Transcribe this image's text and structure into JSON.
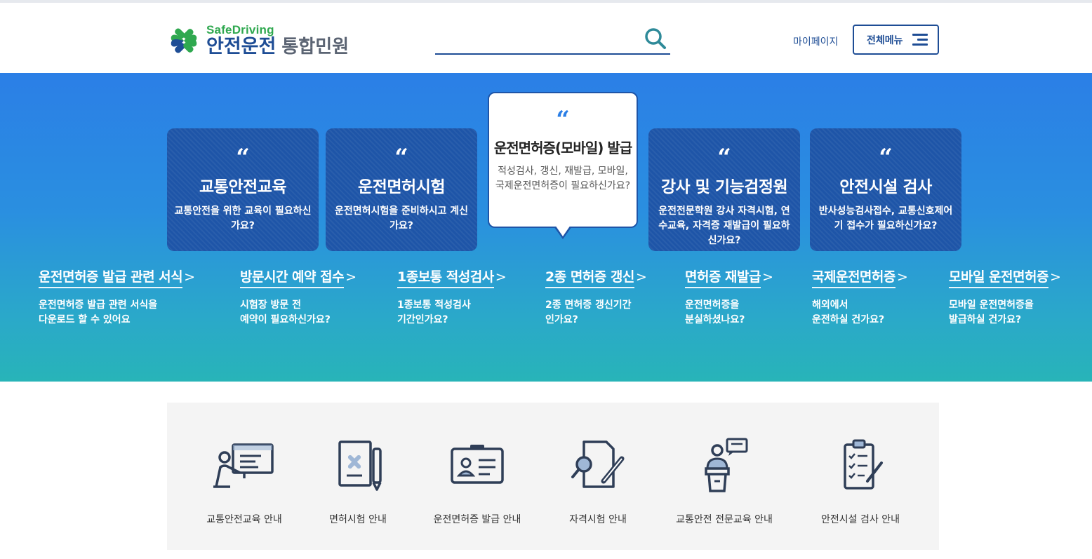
{
  "header": {
    "logo_en": "SafeDriving",
    "logo_ko": "안전운전",
    "logo_sub": "통합민원",
    "search_placeholder": "",
    "mypage": "마이페이지",
    "allmenu": "전체메뉴"
  },
  "colors": {
    "brand_blue": "#1e4d95",
    "brand_green": "#2fa84f",
    "accent_teal": "#2e8a99",
    "hero_top": "#2b7fe6",
    "hero_bottom": "#28b4b8"
  },
  "cards": [
    {
      "title": "교통안전교육",
      "desc": "교통안전을 위한 교육이 필요하신가요?",
      "active": false
    },
    {
      "title": "운전면허시험",
      "desc": "운전면허시험을 준비하시고 계신가요?",
      "active": false
    },
    {
      "title": "운전면허증(모바일) 발급",
      "desc": "적성검사, 갱신, 재발급, 모바일, 국제운전면허증이 필요하신가요?",
      "active": true
    },
    {
      "title": "강사 및 기능검정원",
      "desc": "운전전문학원 강사 자격시험, 연수교육, 자격증 재발급이 필요하신가요?",
      "active": false
    },
    {
      "title": "안전시설 검사",
      "desc": "반사성능검사접수, 교통신호제어기 접수가 필요하신가요?",
      "active": false
    }
  ],
  "quicklinks": [
    {
      "title": "운전면허증 발급 관련 서식",
      "line1": "운전면허증 발급 관련 서식을",
      "line2": "다운로드 할 수 있어요"
    },
    {
      "title": "방문시간 예약 접수",
      "line1": "시험장 방문 전",
      "line2": "예약이 필요하신가요?"
    },
    {
      "title": "1종보통 적성검사",
      "line1": "1종보통 적성검사",
      "line2": "기간인가요?"
    },
    {
      "title": "2종 면허증 갱신",
      "line1": "2종 면허증 갱신기간",
      "line2": "인가요?"
    },
    {
      "title": "면허증 재발급",
      "line1": "운전면허증을",
      "line2": "분실하셨나요?"
    },
    {
      "title": "국제운전면허증",
      "line1": "해외에서",
      "line2": "운전하실 건가요?"
    },
    {
      "title": "모바일 운전면허증",
      "line1": "모바일 운전면허증을",
      "line2": "발급하실 건가요?"
    }
  ],
  "services": [
    {
      "label": "교통안전교육 안내",
      "icon": "teacher-board-icon"
    },
    {
      "label": "면허시험 안내",
      "icon": "document-pen-icon"
    },
    {
      "label": "운전면허증 발급 안내",
      "icon": "id-card-icon"
    },
    {
      "label": "자격시험 안내",
      "icon": "search-document-icon"
    },
    {
      "label": "교통안전 전문교육 안내",
      "icon": "speaker-podium-icon"
    },
    {
      "label": "안전시설 검사 안내",
      "icon": "clipboard-checklist-icon"
    }
  ]
}
